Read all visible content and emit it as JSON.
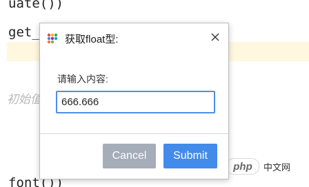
{
  "background_code": {
    "line1": "uate())",
    "line2": "get_",
    "comment": "初始值",
    "line4": "font())"
  },
  "watermark": {
    "logo_text": "php",
    "site_text": "中文网"
  },
  "dialog": {
    "title": "获取float型:",
    "prompt": "请输入内容:",
    "input_value": "666.666",
    "cancel_label": "Cancel",
    "submit_label": "Submit"
  },
  "colors": {
    "submit_button": "#428bea",
    "cancel_button": "#a4adb8",
    "input_border": "#4a8fe7",
    "code_highlight": "#fff7de"
  },
  "icons": {
    "app": "colorful-dots-app-icon",
    "close": "close-icon"
  }
}
